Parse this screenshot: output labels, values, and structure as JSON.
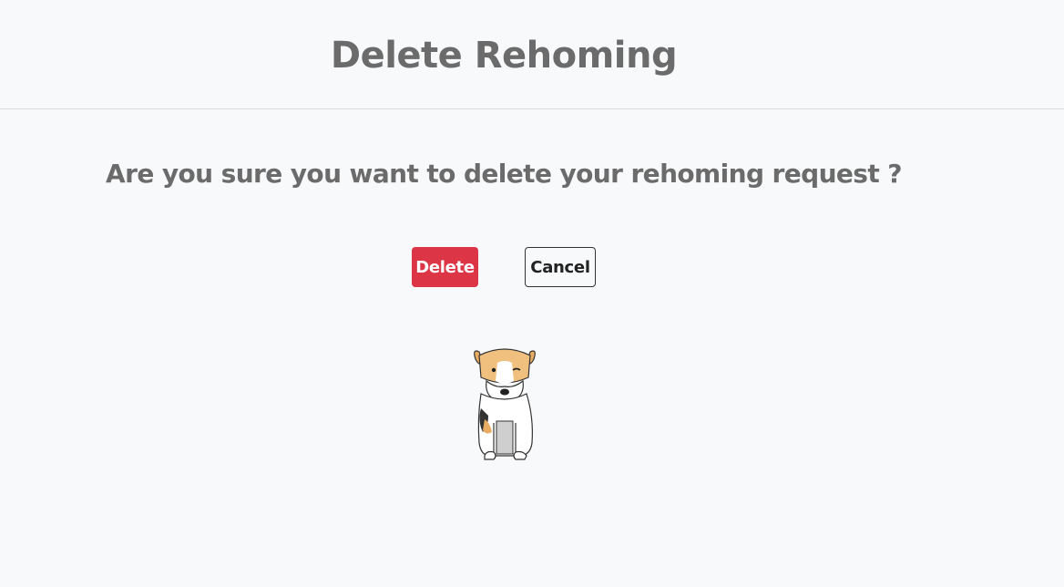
{
  "header": {
    "title": "Delete Rehoming"
  },
  "dialog": {
    "question": "Are you sure you want to delete your rehoming request ?",
    "delete_label": "Delete",
    "cancel_label": "Cancel"
  },
  "illustration": {
    "icon": "fox-terrier-dog-illustration"
  },
  "colors": {
    "danger": "#dc3545",
    "text_muted": "#6b6b6b",
    "background": "#f8f9fa"
  }
}
